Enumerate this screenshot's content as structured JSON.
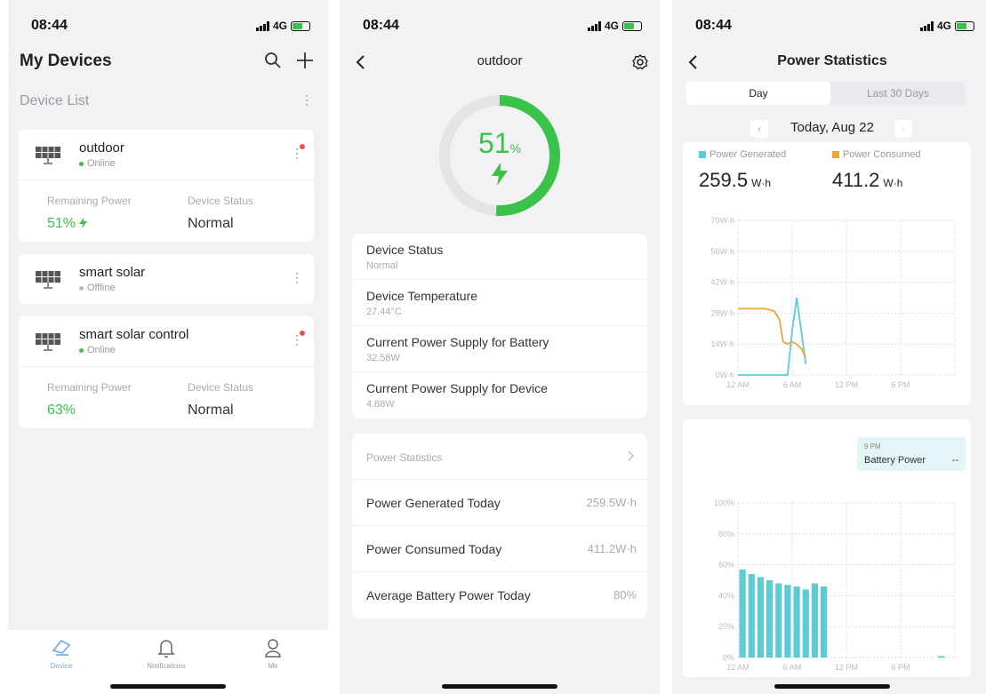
{
  "status_bar": {
    "time": "08:44",
    "network": "4G"
  },
  "screen1": {
    "title": "My Devices",
    "section_title": "Device List",
    "devices": [
      {
        "name": "outdoor",
        "status": "Online",
        "remaining_label": "Remaining Power",
        "remaining_value": "51%",
        "status_label": "Device Status",
        "status_value": "Normal"
      },
      {
        "name": "smart solar",
        "status": "Offline"
      },
      {
        "name": "smart solar control",
        "status": "Online",
        "remaining_label": "Remaining Power",
        "remaining_value": "63%",
        "status_label": "Device Status",
        "status_value": "Normal"
      }
    ],
    "tabs": [
      {
        "label": "Device"
      },
      {
        "label": "Notifications"
      },
      {
        "label": "Me"
      }
    ]
  },
  "screen2": {
    "title": "outdoor",
    "gauge": {
      "value": "51",
      "unit": "%",
      "fraction": 0.51
    },
    "info": [
      {
        "label": "Device Status",
        "value": "Normal"
      },
      {
        "label": "Device Temperature",
        "value": "27.44°C"
      },
      {
        "label": "Current Power Supply for Battery",
        "value": "32.58W"
      },
      {
        "label": "Current Power Supply for Device",
        "value": "4.88W"
      }
    ],
    "stats_header": "Power Statistics",
    "stats": [
      {
        "label": "Power Generated Today",
        "value": "259.5W·h"
      },
      {
        "label": "Power Consumed Today",
        "value": "411.2W·h"
      },
      {
        "label": "Average Battery Power Today",
        "value": "80%"
      }
    ]
  },
  "screen3": {
    "title": "Power Statistics",
    "tabs": [
      "Day",
      "Last 30 Days"
    ],
    "date": "Today, Aug 22",
    "legend_generated": "Power Generated",
    "legend_consumed": "Power Consumed",
    "generated_value": "259.5",
    "consumed_value": "411.2",
    "unit": "W·h",
    "tooltip": {
      "time": "9 PM",
      "label": "Battery Power",
      "value": "--"
    },
    "colors": {
      "generated": "#5ccbd6",
      "consumed": "#f5a23a",
      "accent": "#3ac24a"
    }
  },
  "chart_data": [
    {
      "type": "line",
      "x_ticks": [
        "12 AM",
        "6 AM",
        "12 PM",
        "6 PM"
      ],
      "y_ticks": [
        "70W·h",
        "56W·h",
        "42W·h",
        "28W·h",
        "14W·h",
        "0W·h"
      ],
      "ylim": [
        0,
        70
      ],
      "xlim": [
        0,
        24
      ],
      "grid": true,
      "series": [
        {
          "name": "Power Generated",
          "points": [
            [
              0,
              0
            ],
            [
              1,
              0
            ],
            [
              2,
              0
            ],
            [
              3,
              0
            ],
            [
              4,
              0
            ],
            [
              5,
              0
            ],
            [
              5.5,
              0
            ],
            [
              6,
              20
            ],
            [
              6.5,
              35
            ],
            [
              7,
              20
            ],
            [
              7.5,
              5
            ]
          ]
        },
        {
          "name": "Power Consumed",
          "points": [
            [
              0,
              30
            ],
            [
              1,
              30
            ],
            [
              2,
              30
            ],
            [
              3,
              30
            ],
            [
              4,
              29
            ],
            [
              4.6,
              25
            ],
            [
              5,
              15
            ],
            [
              5.5,
              14
            ],
            [
              6,
              15
            ],
            [
              6.5,
              14
            ],
            [
              7,
              12
            ],
            [
              7.5,
              8
            ]
          ]
        }
      ]
    },
    {
      "type": "bar",
      "x_ticks": [
        "12 AM",
        "6 AM",
        "12 PM",
        "6 PM"
      ],
      "y_ticks": [
        "100%",
        "80%",
        "60%",
        "40%",
        "20%",
        "0%"
      ],
      "ylim": [
        0,
        100
      ],
      "grid": true,
      "series": [
        {
          "name": "Battery Power",
          "x": [
            0,
            1,
            2,
            3,
            4,
            5,
            6,
            7,
            8,
            9,
            10,
            11,
            12,
            13,
            14,
            15,
            16,
            17,
            18,
            19,
            20,
            21,
            22,
            23
          ],
          "values": [
            57,
            54,
            52,
            50,
            48,
            47,
            46,
            44,
            48,
            46,
            null,
            null,
            null,
            null,
            null,
            null,
            null,
            null,
            null,
            null,
            null,
            null,
            1,
            null
          ]
        }
      ]
    }
  ]
}
